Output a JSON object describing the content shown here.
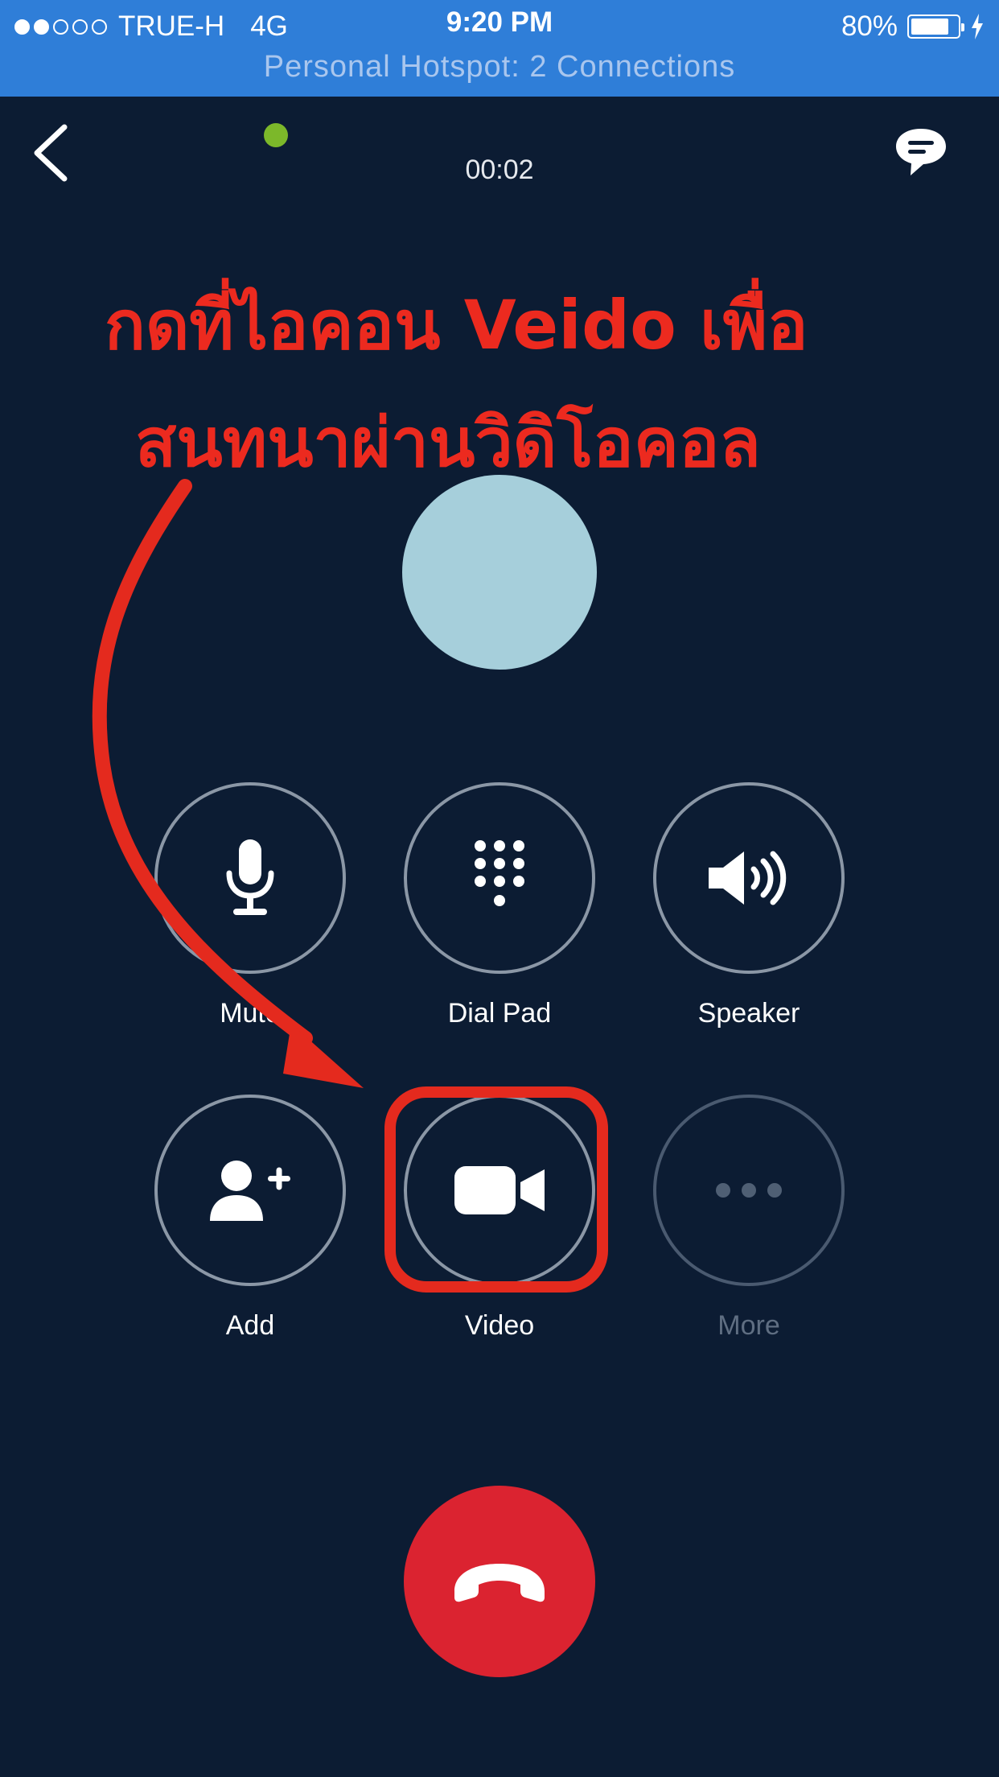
{
  "status_bar": {
    "carrier": "TRUE-H",
    "network": "4G",
    "time": "9:20 PM",
    "battery": "80%",
    "battery_level": 0.8,
    "hotspot": "Personal Hotspot: 2 Connections"
  },
  "header": {
    "back_icon": "chevron-left-icon",
    "presence_color": "#7cb82a",
    "call_timer": "00:02",
    "chat_icon": "chat-bubble-icon"
  },
  "annotation": {
    "line1": "กดที่ไอคอน Veido เพื่อ",
    "line2": "สนทนาผ่านวิดิโอคอล",
    "color": "#ec2a1f"
  },
  "controls": {
    "mute": {
      "label": "Mute",
      "icon": "microphone-icon"
    },
    "dialpad": {
      "label": "Dial Pad",
      "icon": "dialpad-icon"
    },
    "speaker": {
      "label": "Speaker",
      "icon": "speaker-icon"
    },
    "add": {
      "label": "Add",
      "icon": "add-person-icon"
    },
    "video": {
      "label": "Video",
      "icon": "video-camera-icon"
    },
    "more": {
      "label": "More",
      "icon": "more-dots-icon"
    }
  },
  "end_call": {
    "icon": "hang-up-icon",
    "color": "#db2330"
  }
}
